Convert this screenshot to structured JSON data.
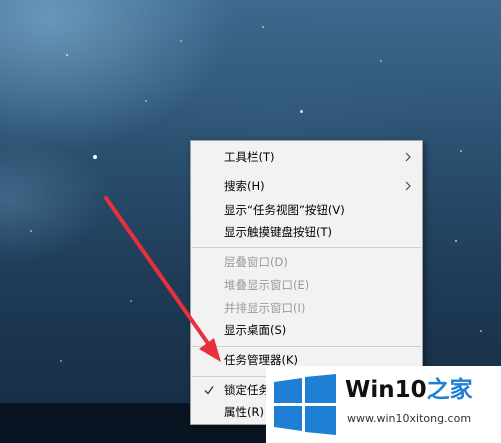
{
  "context_menu": {
    "items": [
      {
        "label": "工具栏(T)",
        "has_submenu": true
      },
      {
        "label": "搜索(H)",
        "has_submenu": true
      },
      {
        "label": "显示“任务视图”按钮(V)"
      },
      {
        "label": "显示触摸键盘按钮(T)"
      },
      {
        "label": "层叠窗口(D)",
        "disabled": true
      },
      {
        "label": "堆叠显示窗口(E)",
        "disabled": true
      },
      {
        "label": "并排显示窗口(I)",
        "disabled": true
      },
      {
        "label": "显示桌面(S)"
      },
      {
        "label": "任务管理器(K)"
      },
      {
        "label": "锁定任务栏(L)",
        "checked": true
      },
      {
        "label": "属性(R)"
      }
    ]
  },
  "watermark": {
    "brand": "Win10",
    "brand_suffix": "之家",
    "url": "www.win10xitong.com"
  },
  "colors": {
    "windows_blue": "#1f7fd4",
    "annotation_red": "#e8303a",
    "menu_bg": "#f2f2f2"
  }
}
